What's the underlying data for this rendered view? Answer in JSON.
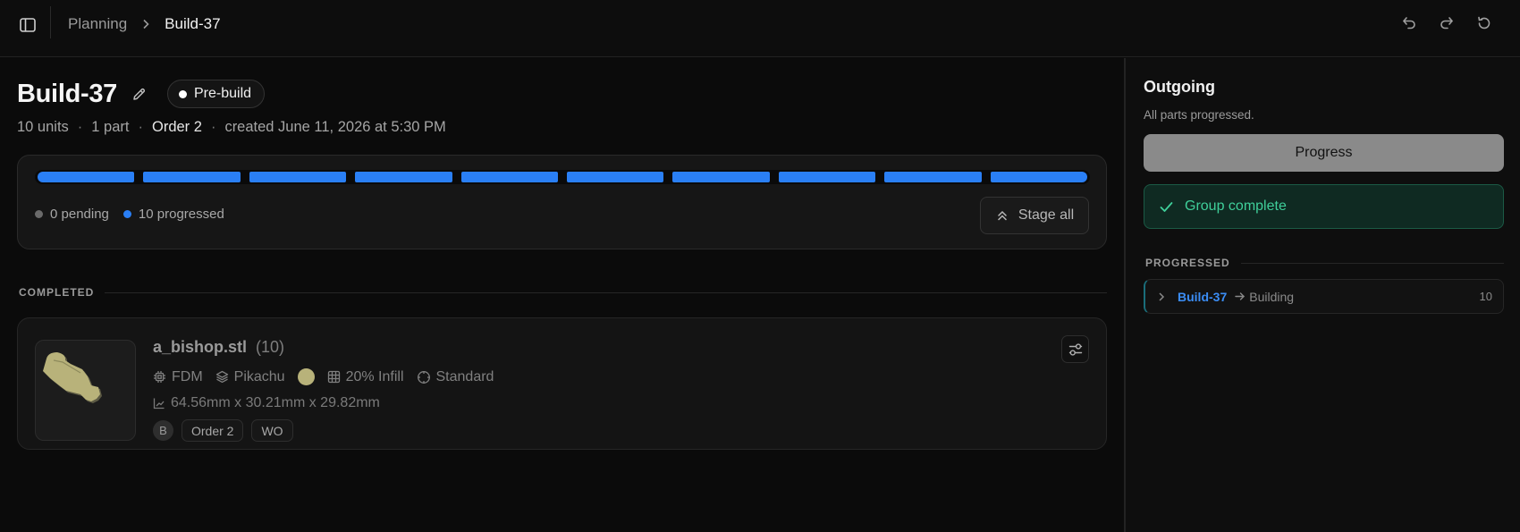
{
  "breadcrumb": {
    "parent": "Planning",
    "current": "Build-37"
  },
  "header": {
    "title": "Build-37",
    "status": "Pre-build"
  },
  "meta": {
    "units": "10 units",
    "parts": "1 part",
    "order": "Order 2",
    "created": "created June 11, 2026 at 5:30 PM",
    "separator": "·"
  },
  "progress": {
    "total_segments": 10,
    "progressed": 10,
    "pending_label": "0 pending",
    "progressed_label": "10 progressed",
    "stage_all_label": "Stage all",
    "colors": {
      "progressed": "#2a7ff5",
      "pending": "#6a6a6a"
    }
  },
  "completed": {
    "section_label": "COMPLETED",
    "part": {
      "name": "a_bishop.stl",
      "count": "(10)",
      "process": "FDM",
      "material": "Pikachu",
      "color": "#b8b27a",
      "infill": "20% Infill",
      "quality": "Standard",
      "dimensions": "64.56mm x 30.21mm x 29.82mm",
      "avatar": "B",
      "tags": [
        "Order 2",
        "WO"
      ]
    }
  },
  "outgoing": {
    "title": "Outgoing",
    "subtitle": "All parts progressed.",
    "progress_button": "Progress",
    "group_complete": "Group complete",
    "section_label": "PROGRESSED",
    "row": {
      "build": "Build-37",
      "stage": "Building",
      "count": "10"
    }
  }
}
